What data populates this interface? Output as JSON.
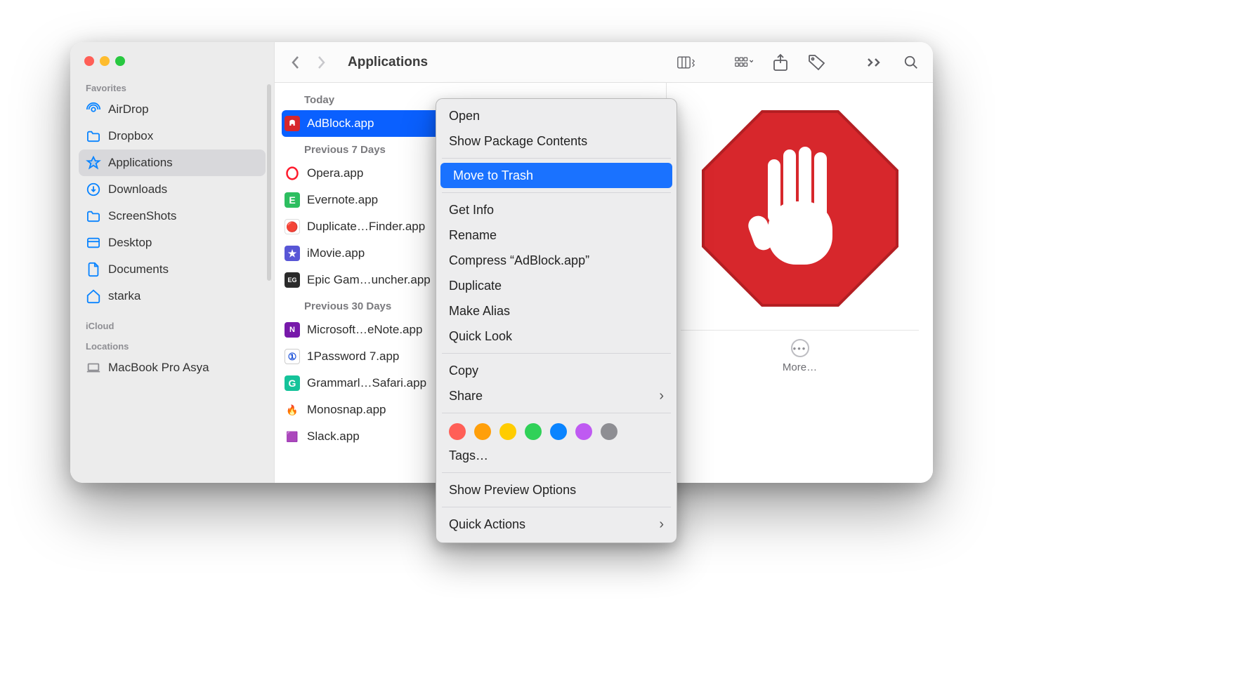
{
  "window_title": "Applications",
  "sidebar": {
    "headings": {
      "favorites": "Favorites",
      "icloud": "iCloud",
      "locations": "Locations"
    },
    "items": [
      {
        "label": "AirDrop"
      },
      {
        "label": "Dropbox"
      },
      {
        "label": "Applications"
      },
      {
        "label": "Downloads"
      },
      {
        "label": "ScreenShots"
      },
      {
        "label": "Desktop"
      },
      {
        "label": "Documents"
      },
      {
        "label": "starka"
      }
    ],
    "locations": [
      {
        "label": "MacBook Pro Asya"
      }
    ]
  },
  "list": {
    "groups": {
      "today": "Today",
      "prev7": "Previous 7 Days",
      "prev30": "Previous 30 Days"
    },
    "today": [
      {
        "label": "AdBlock.app"
      }
    ],
    "prev7": [
      {
        "label": "Opera.app"
      },
      {
        "label": "Evernote.app"
      },
      {
        "label": "Duplicate…Finder.app"
      },
      {
        "label": "iMovie.app"
      },
      {
        "label": "Epic Gam…uncher.app"
      }
    ],
    "prev30": [
      {
        "label": "Microsoft…eNote.app"
      },
      {
        "label": "1Password 7.app"
      },
      {
        "label": "Grammarl…Safari.app"
      },
      {
        "label": "Monosnap.app"
      },
      {
        "label": "Slack.app"
      }
    ]
  },
  "context_menu": {
    "open": "Open",
    "show_package": "Show Package Contents",
    "move_to_trash": "Move to Trash",
    "get_info": "Get Info",
    "rename": "Rename",
    "compress": "Compress “AdBlock.app”",
    "duplicate": "Duplicate",
    "make_alias": "Make Alias",
    "quick_look": "Quick Look",
    "copy": "Copy",
    "share": "Share",
    "tags": "Tags…",
    "preview_opts": "Show Preview Options",
    "quick_actions": "Quick Actions"
  },
  "preview": {
    "more_label": "More…"
  }
}
